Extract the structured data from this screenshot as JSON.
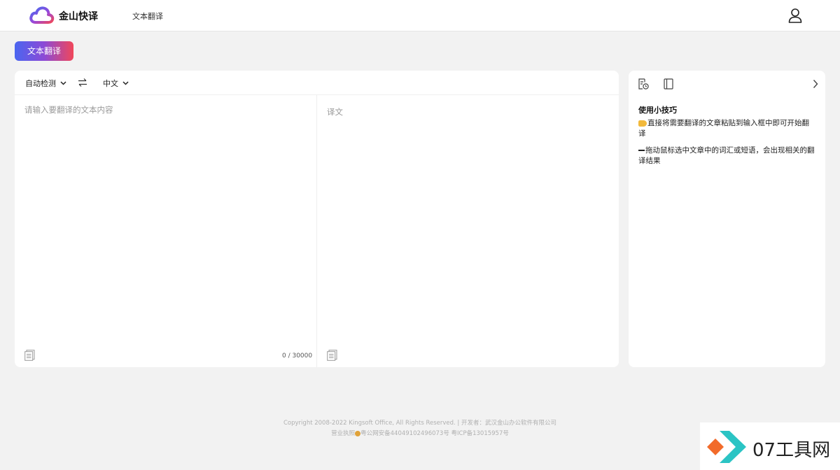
{
  "header": {
    "brand": "金山快译",
    "nav_link": "文本翻译"
  },
  "tab": {
    "label": "文本翻译"
  },
  "translator": {
    "source_lang": "自动检测",
    "target_lang": "中文",
    "source_placeholder": "请输入要翻译的文本内容",
    "source_value": "",
    "target_placeholder": "译文",
    "char_count": "0 / 30000"
  },
  "tips": {
    "title": "使用小技巧",
    "tip1": "直接将需要翻译的文章粘贴到输入框中即可开始翻译",
    "tip2": "拖动鼠标选中文章中的词汇或短语，会出现相关的翻译结果"
  },
  "footer": {
    "copyright": "Copyright 2008-2022 Kingsoft Office, All Rights Reserved. | 开发者：武汉金山办公软件有限公司",
    "license_prefix": "营业执照",
    "license_rest": "粤公网安备44049102496073号 粤ICP备13015957号"
  },
  "watermark": {
    "text": "07工具网"
  },
  "colors": {
    "accent_start": "#4a66f0",
    "accent_mid": "#8c4ad6",
    "accent_end": "#f0475a",
    "watermark_orange": "#f26b2a",
    "watermark_teal": "#2bc4c4"
  }
}
